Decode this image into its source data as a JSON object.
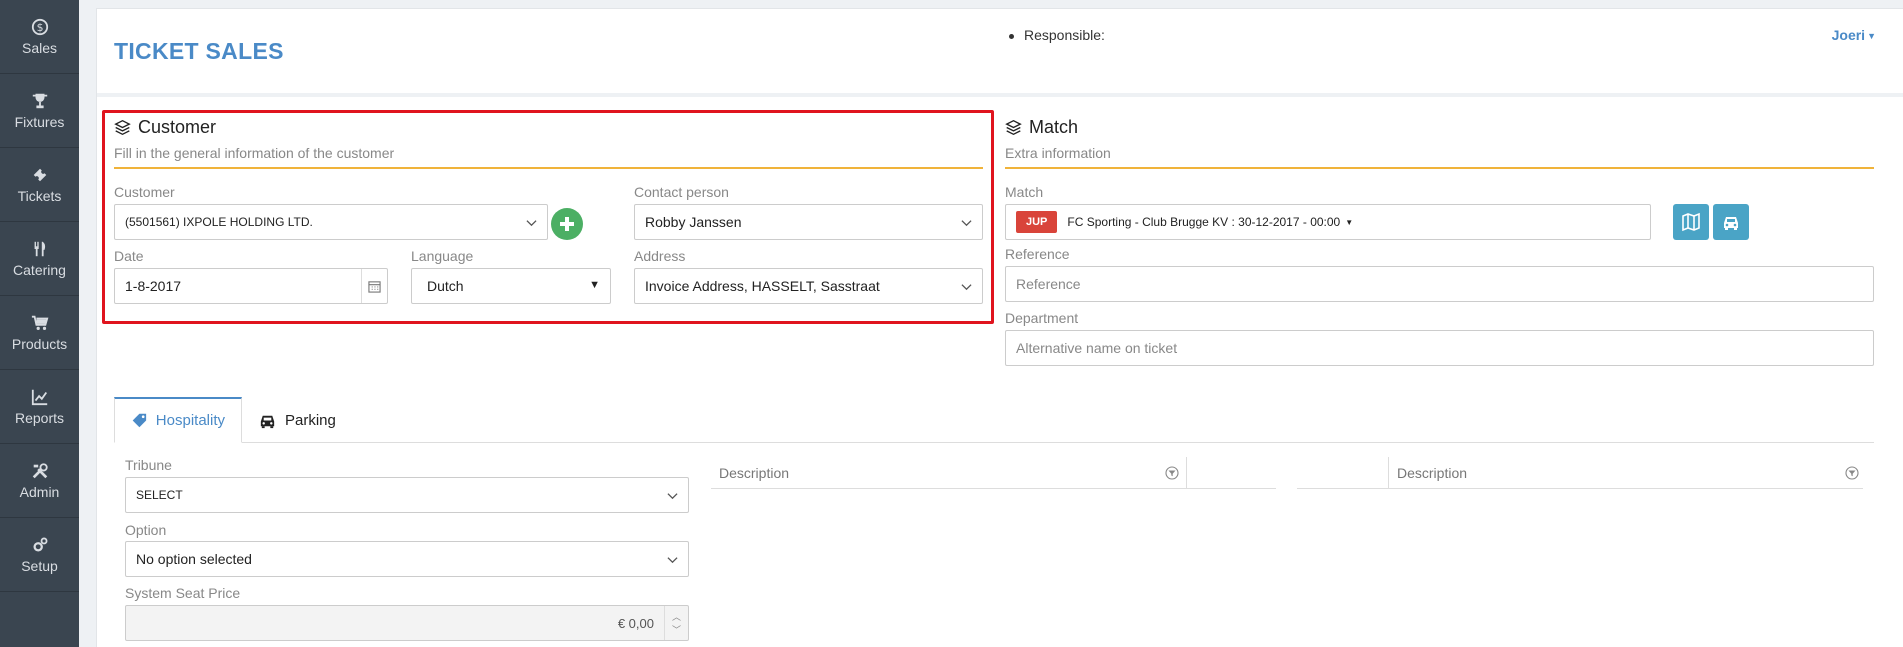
{
  "sidebar": {
    "items": [
      {
        "label": "Sales",
        "icon": "dollar-icon"
      },
      {
        "label": "Fixtures",
        "icon": "trophy-icon"
      },
      {
        "label": "Tickets",
        "icon": "ticket-icon"
      },
      {
        "label": "Catering",
        "icon": "cutlery-icon"
      },
      {
        "label": "Products",
        "icon": "cart-icon"
      },
      {
        "label": "Reports",
        "icon": "chart-icon"
      },
      {
        "label": "Admin",
        "icon": "tools-icon"
      },
      {
        "label": "Setup",
        "icon": "gears-icon"
      }
    ]
  },
  "header": {
    "title": "TICKET SALES",
    "responsible_label": "Responsible:",
    "user": "Joeri"
  },
  "customer_section": {
    "title": "Customer",
    "subtitle": "Fill in the general information of the customer",
    "customer_label": "Customer",
    "customer_value": "(5501561) IXPOLE HOLDING LTD.",
    "contact_label": "Contact person",
    "contact_value": "Robby Janssen",
    "date_label": "Date",
    "date_value": "1-8-2017",
    "language_label": "Language",
    "language_value": "Dutch",
    "address_label": "Address",
    "address_value": "Invoice Address, HASSELT, Sasstraat"
  },
  "match_section": {
    "title": "Match",
    "subtitle": "Extra information",
    "match_label": "Match",
    "match_badge": "JUP",
    "match_value": "FC Sporting - Club Brugge KV : 30-12-2017 - 00:00",
    "reference_label": "Reference",
    "reference_placeholder": "Reference",
    "department_label": "Department",
    "department_placeholder": "Alternative name on ticket"
  },
  "tabs": [
    {
      "label": "Hospitality",
      "active": true
    },
    {
      "label": "Parking",
      "active": false
    }
  ],
  "hospitality": {
    "tribune_label": "Tribune",
    "tribune_value": "SELECT",
    "option_label": "Option",
    "option_value": "No option selected",
    "seat_price_label": "System Seat Price",
    "seat_price_value": "€ 0,00"
  },
  "grids": {
    "left_header": "Description",
    "right_header": "Description"
  },
  "colors": {
    "sidebar_bg": "#3a4550",
    "accent_blue": "#4a8ac7",
    "section_underline": "#f0b33a",
    "highlight_box": "#e0141e",
    "add_button": "#4caf64",
    "badge_red": "#d9443a",
    "action_button": "#4aa4c6"
  }
}
